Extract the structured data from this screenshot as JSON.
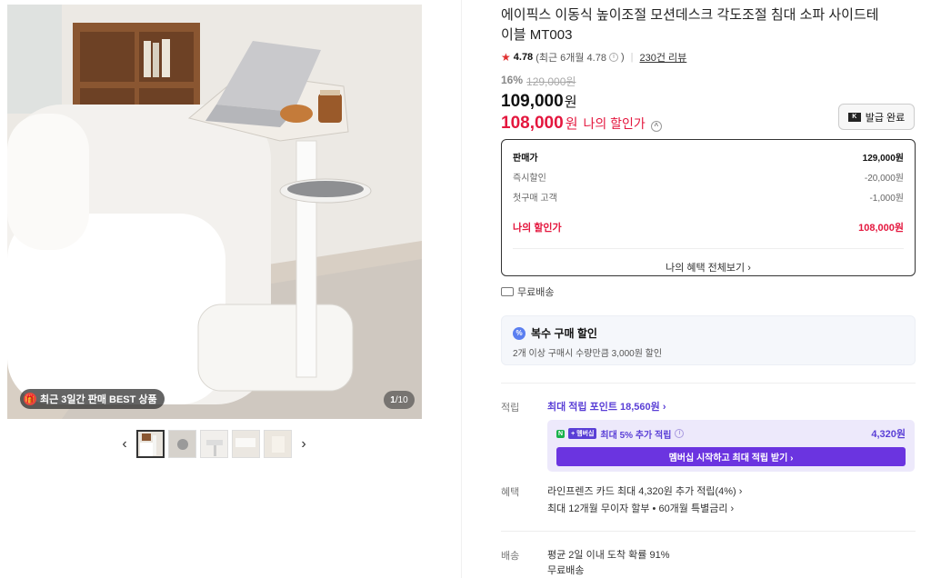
{
  "gallery": {
    "badge_icon": "gift-icon",
    "badge_text": "최근 3일간 판매 BEST 상품",
    "counter_current": "1",
    "counter_total": "/10",
    "prev_arrow": "‹",
    "next_arrow": "›",
    "thumbnails": [
      "thumb-1",
      "thumb-2",
      "thumb-3",
      "thumb-4",
      "thumb-5"
    ]
  },
  "product": {
    "title": "에이픽스 이동식 높이조절 모션데스크 각도조절 침대 소파 사이드테이블 MT003",
    "rating_score": "4.78",
    "rating_recent": "(최근 6개월 4.78",
    "rating_info": "i",
    "rating_close": ")",
    "review_link": "230건 리뷰"
  },
  "price": {
    "discount_pct": "16%",
    "original": "129,000원",
    "sale": "109,000",
    "won": "원",
    "my_price": "108,000",
    "my_label": "나의 할인가",
    "toggle_icon": "^",
    "coupon_button": "발급 완료",
    "coupon_icon_text": "K"
  },
  "breakdown": {
    "rows": [
      {
        "label": "판매가",
        "value": "129,000원"
      },
      {
        "label": "즉시할인",
        "value": "-20,000원"
      },
      {
        "label": "첫구매 고객",
        "value": "-1,000원"
      }
    ],
    "my_label": "나의 할인가",
    "my_value": "108,000원",
    "more_link": "나의 혜택 전체보기 ›"
  },
  "shipping_tag": "무료배송",
  "multi_buy": {
    "icon_text": "%",
    "title": "복수 구매 할인",
    "desc": "2개 이상 구매시 수량만큼 3,000원 할인"
  },
  "points": {
    "label": "적립",
    "link": "최대 적립 포인트 18,560원 ›",
    "n_badge": "N",
    "member_badge": "+ 멤버십",
    "member_text": "최대 5% 추가 적립",
    "member_info": "i",
    "member_amount": "4,320원",
    "member_button": "멤버십 시작하고 최대 적립 받기 ›"
  },
  "benefits": {
    "label": "혜택",
    "line1": "라인프렌즈 카드 최대 4,320원 추가 적립(4%) ›",
    "line2": "최대 12개월 무이자 할부 • 60개월 특별금리 ›"
  },
  "delivery": {
    "label": "배송",
    "line1": "평균 2일 이내 도착 확률 91%",
    "line2": "무료배송"
  },
  "colors": {
    "accent_red": "#e4173e",
    "accent_purple": "#6b34e0",
    "rating_star": "#e03131"
  }
}
